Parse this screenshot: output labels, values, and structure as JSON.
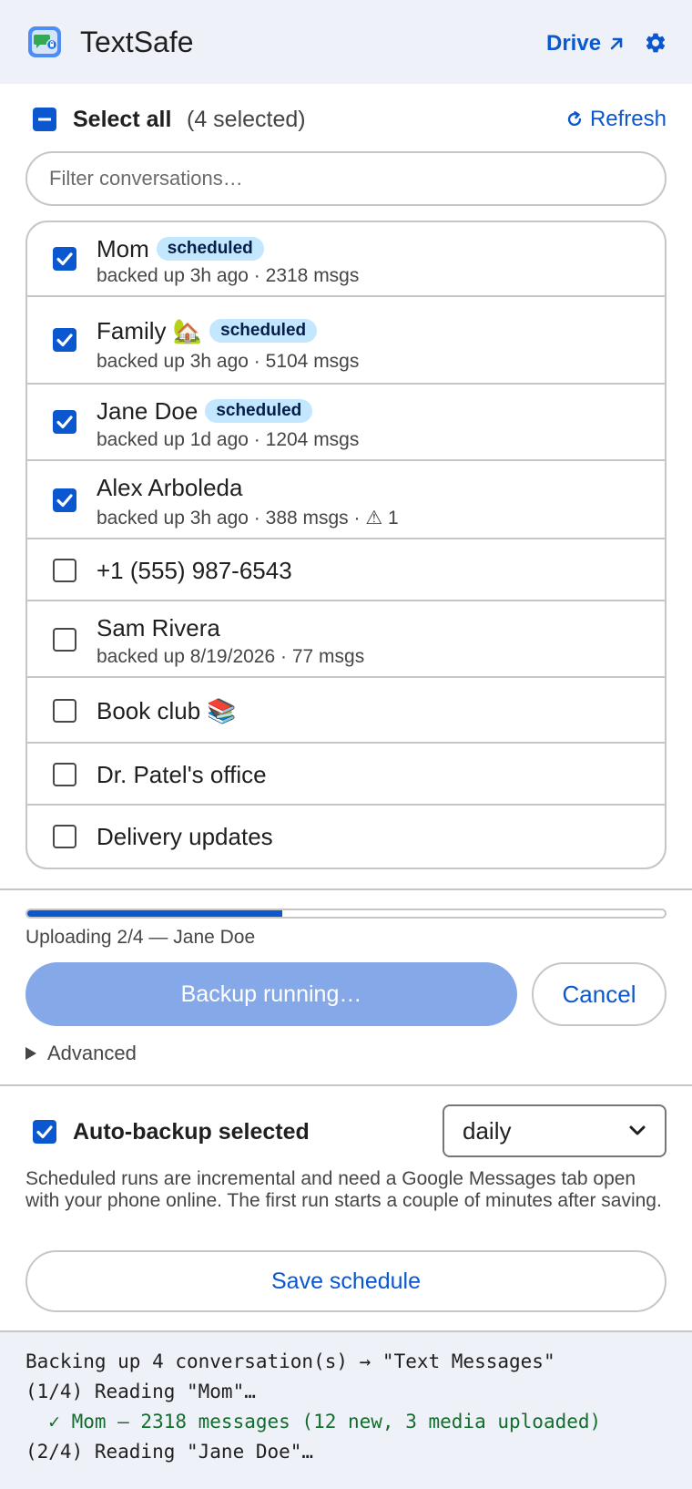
{
  "header": {
    "app_name": "TextSafe",
    "drive_label": "Drive",
    "colors": {
      "accent": "#0b57d0",
      "header_bg": "#eef2f8"
    }
  },
  "selection": {
    "select_all_label": "Select all",
    "selected_count_text": "(4 selected)",
    "refresh_label": "Refresh"
  },
  "filter": {
    "placeholder": "Filter conversations…",
    "value": ""
  },
  "conversations": [
    {
      "name": "Mom",
      "checked": true,
      "badge": "scheduled",
      "meta": "backed up 3h ago · 2318 msgs"
    },
    {
      "name": "Family 🏡",
      "checked": true,
      "badge": "scheduled",
      "meta": "backed up 3h ago · 5104 msgs"
    },
    {
      "name": "Jane Doe",
      "checked": true,
      "badge": "scheduled",
      "meta": "backed up 1d ago · 1204 msgs"
    },
    {
      "name": "Alex Arboleda",
      "checked": true,
      "badge": "",
      "meta": "backed up 3h ago · 388 msgs · ⚠ 1"
    },
    {
      "name": "+1 (555) 987-6543",
      "checked": false,
      "badge": "",
      "meta": ""
    },
    {
      "name": "Sam Rivera",
      "checked": false,
      "badge": "",
      "meta": "backed up 8/19/2026 · 77 msgs"
    },
    {
      "name": "Book club 📚",
      "checked": false,
      "badge": "",
      "meta": ""
    },
    {
      "name": "Dr. Patel's office",
      "checked": false,
      "badge": "",
      "meta": ""
    },
    {
      "name": "Delivery updates",
      "checked": false,
      "badge": "",
      "meta": ""
    }
  ],
  "progress": {
    "fraction": 0.4,
    "status_text": "Uploading 2/4 — Jane Doe",
    "running_label": "Backup running…",
    "cancel_label": "Cancel",
    "advanced_label": "Advanced"
  },
  "schedule": {
    "auto_backup_label": "Auto-backup selected",
    "auto_backup_checked": true,
    "frequency_value": "daily",
    "note": "Scheduled runs are incremental and need a Google Messages tab open with your phone online. The first run starts a couple of minutes after saving.",
    "save_label": "Save schedule"
  },
  "log": [
    {
      "text": "Backing up 4 conversation(s) → \"Text Messages\"",
      "ok": false
    },
    {
      "text": "(1/4) Reading \"Mom\"…",
      "ok": false
    },
    {
      "text": "  ✓ Mom — 2318 messages (12 new, 3 media uploaded)",
      "ok": true
    },
    {
      "text": "(2/4) Reading \"Jane Doe\"…",
      "ok": false
    }
  ]
}
